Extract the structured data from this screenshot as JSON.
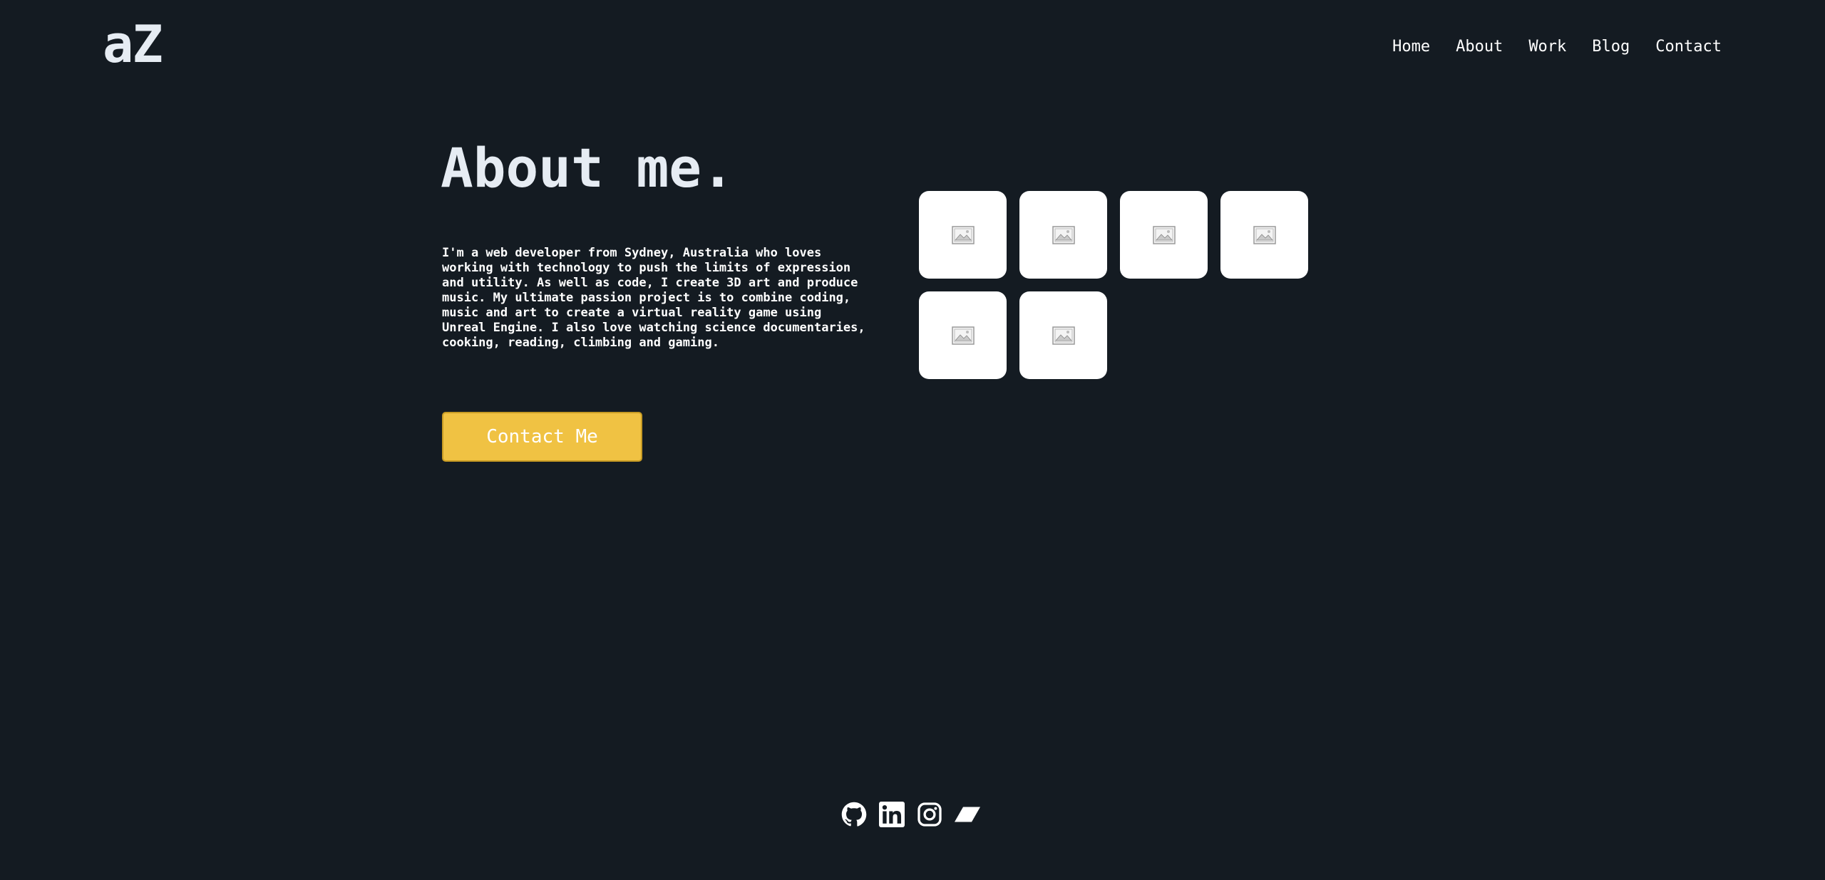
{
  "header": {
    "logo": "aZ",
    "nav": [
      {
        "label": "Home"
      },
      {
        "label": "About"
      },
      {
        "label": "Work"
      },
      {
        "label": "Blog"
      },
      {
        "label": "Contact"
      }
    ]
  },
  "main": {
    "title": "About me.",
    "bio": "I'm a web developer from Sydney, Australia who loves working with technology to push the limits of expression and utility. As well as code, I create 3D art and produce music. My ultimate passion project is to combine coding, music and art to create a virtual reality game using Unreal Engine. I also love watching science documentaries, cooking, reading, climbing and gaming.",
    "contact_button": "Contact Me",
    "gallery_count": 6
  },
  "footer": {
    "social": [
      {
        "icon": "github-icon"
      },
      {
        "icon": "linkedin-icon"
      },
      {
        "icon": "instagram-icon"
      },
      {
        "icon": "parallelogram-icon"
      }
    ]
  },
  "colors": {
    "background": "#141b22",
    "accent": "#f0c243",
    "text": "#e6ecf3"
  }
}
